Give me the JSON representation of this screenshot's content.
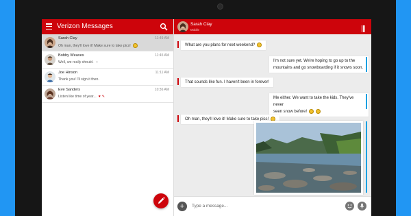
{
  "app": {
    "title": "Verizon Messages"
  },
  "conversations": [
    {
      "name": "Sarah Clay",
      "preview": "Oh man, they'll love it! Make sure to take pics!",
      "time": "11:49 AM"
    },
    {
      "name": "Bobby Weaves",
      "preview": "Well, we really should.",
      "time": "11:45 AM"
    },
    {
      "name": "Joe Hinson",
      "preview": "Thank you! I'll sign it then.",
      "time": "11:11 AM"
    },
    {
      "name": "Eve Sanders",
      "preview": "Listen like time of year...",
      "time": "10:36 AM"
    }
  ],
  "chat": {
    "name": "Sarah Clay",
    "subtitle": "Mobile"
  },
  "messages": [
    {
      "dir": "in",
      "text": "What are you plans for next weekend?"
    },
    {
      "dir": "out",
      "lines": [
        "I'm not sure yet. We're hoping to go up to the",
        "mountains and go snowboarding if it snows soon."
      ]
    },
    {
      "dir": "in",
      "text": "That sounds like fun. I haven't been in forever!"
    },
    {
      "dir": "out",
      "lines": [
        "Me either. We want to take the kids. They've never",
        "seen snow before!"
      ]
    },
    {
      "dir": "in",
      "text": "Oh man, they'll love it! Make sure to take pics!"
    }
  ],
  "composer": {
    "placeholder": "Type a message..."
  },
  "colors": {
    "brand": "#cd040b",
    "outgoing": "#1ba1e2",
    "background": "#2196f3"
  },
  "icons": [
    "menu-icon",
    "search-icon",
    "compose-icon",
    "overflow-icon",
    "add-icon",
    "emoji-icon",
    "mic-icon"
  ]
}
